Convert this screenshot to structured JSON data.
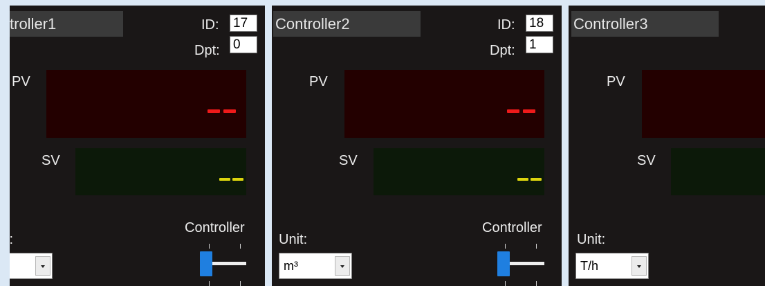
{
  "panels": [
    {
      "title": "troller1",
      "id_label": "ID:",
      "id_value": "17",
      "dpt_label": "Dpt:",
      "dpt_value": "0",
      "pv_label": "PV",
      "sv_label": "SV",
      "unit_label": "t:",
      "unit_value": "",
      "mode_label": "Controller"
    },
    {
      "title": "Controller2",
      "id_label": "ID:",
      "id_value": "18",
      "dpt_label": "Dpt:",
      "dpt_value": "1",
      "pv_label": "PV",
      "sv_label": "SV",
      "unit_label": "Unit:",
      "unit_value": "m³",
      "mode_label": "Controller"
    },
    {
      "title": "Controller3",
      "pv_label": "PV",
      "sv_label": "SV",
      "unit_label": "Unit:",
      "unit_value": "T/h"
    }
  ],
  "colors": {
    "panel_bg": "#1a1717",
    "pv_display_bg": "#230000",
    "sv_display_bg": "#0c1909",
    "pv_digits": "#ee1a1a",
    "sv_digits": "#dcd40e",
    "slider_thumb": "#1f7fe0"
  }
}
